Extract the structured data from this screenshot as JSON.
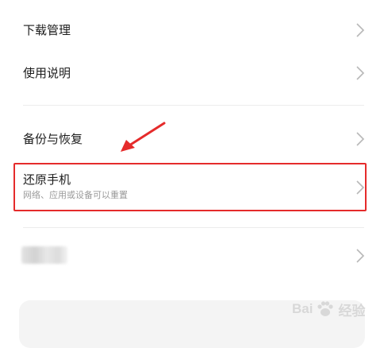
{
  "settings": {
    "items": [
      {
        "label": "下载管理"
      },
      {
        "label": "使用说明"
      },
      {
        "label": "备份与恢复"
      },
      {
        "label": "还原手机",
        "sublabel": "网络、应用或设备可以重置"
      },
      {
        "label": ""
      }
    ]
  },
  "annotation": {
    "highlight_color": "#e52b2b"
  },
  "watermark": {
    "text": "Bai",
    "text2": "经验",
    "logo_icon": "paw-icon"
  }
}
